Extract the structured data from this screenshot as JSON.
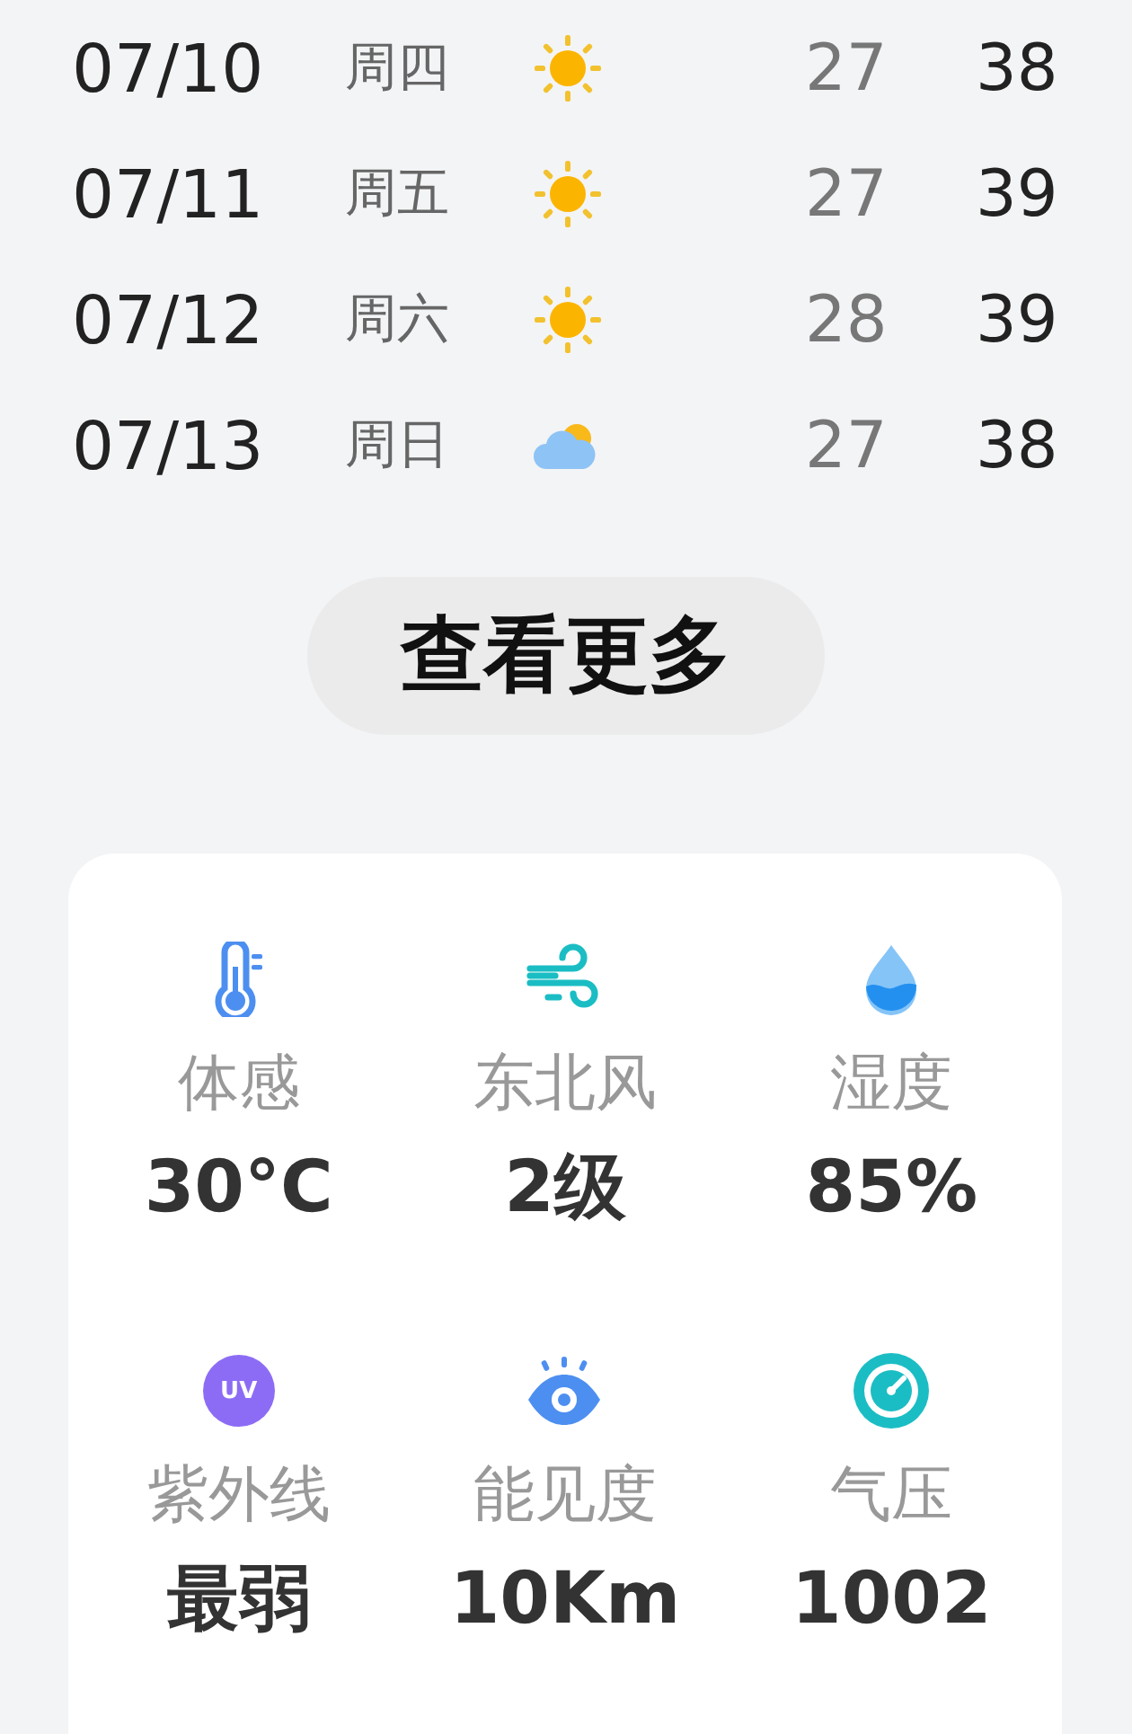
{
  "forecast": [
    {
      "date": "07/10",
      "weekday": "周四",
      "kind": "sunny",
      "low": "27",
      "high": "38"
    },
    {
      "date": "07/11",
      "weekday": "周五",
      "kind": "sunny",
      "low": "27",
      "high": "39"
    },
    {
      "date": "07/12",
      "weekday": "周六",
      "kind": "sunny",
      "low": "28",
      "high": "39"
    },
    {
      "date": "07/13",
      "weekday": "周日",
      "kind": "partly_cloudy",
      "low": "27",
      "high": "38"
    }
  ],
  "more_button": "查看更多",
  "details": [
    {
      "kind": "thermometer",
      "label": "体感",
      "value": "30°C"
    },
    {
      "kind": "wind",
      "label": "东北风",
      "value": "2级"
    },
    {
      "kind": "drop",
      "label": "湿度",
      "value": "85%"
    },
    {
      "kind": "uv",
      "badge": "UV",
      "label": "紫外线",
      "value": "最弱"
    },
    {
      "kind": "eye",
      "label": "能见度",
      "value": "10Km"
    },
    {
      "kind": "gauge",
      "label": "气压",
      "value": "1002"
    }
  ]
}
